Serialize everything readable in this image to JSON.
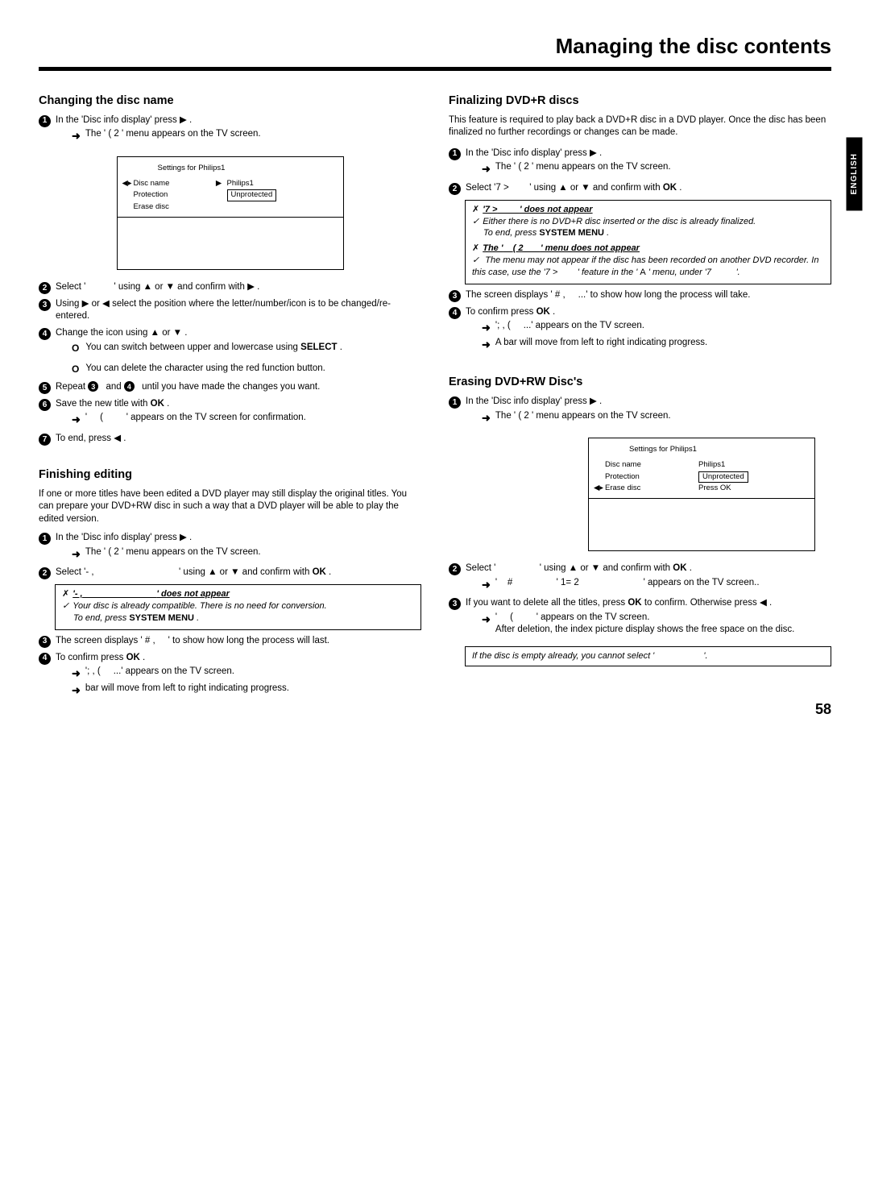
{
  "page_title": "Managing the disc contents",
  "page_number": "58",
  "lang_tab": "ENGLISH",
  "section_changing": {
    "heading": "Changing the disc name",
    "s1a": "In the 'Disc info display' press  ▶ .",
    "s1b_pre": "The '",
    "s1b_mid": "( 2",
    "s1b_post": "' menu appears on the TV screen.",
    "screenshot_title": "Settings for Philips1",
    "screenshot_rows": {
      "r1_label": "Disc name",
      "r1_val": "Philips1",
      "r2_label": "Protection",
      "r2_val": "Unprotected",
      "r3_label": "Erase disc"
    },
    "s2_pre": "Select '",
    "s2_post": "' using  ▲  or  ▼  and confirm with  ▶ .",
    "s3": "Using  ▶  or  ◀  select the position where the letter/number/icon is to be changed/re-entered.",
    "s4": "Change the icon using  ▲  or  ▼ .",
    "s4o1_pre": "You can switch between upper and lowercase using ",
    "s4o1_sel": "SELECT",
    "s4o1_post": " .",
    "s4o2": "You can delete the character using the red function button.",
    "s5_pre": "Repeat ",
    "s5_mid": " and ",
    "s5_post": " until you have made the changes you want.",
    "s6_pre": "Save the new title with  ",
    "s6_ok": "OK",
    "s6_post": " .",
    "s6sub_pre": "'",
    "s6sub_mid": "(",
    "s6sub_post": "' appears on the TV screen for confirmation.",
    "s7": "To end, press  ◀ ."
  },
  "section_finishing": {
    "heading": "Finishing editing",
    "intro": "If one or more titles have been edited a DVD player may still display the original titles. You can prepare your DVD+RW disc in such a way that a DVD player will be able to play the edited version.",
    "s1a": "In the 'Disc info display' press  ▶ .",
    "s1b_pre": "The '",
    "s1b_mid": "( 2",
    "s1b_post": "' menu appears on the TV screen.",
    "s2_pre": "Select '- ,",
    "s2_mid": "' using  ▲  or  ▼  and confirm with  ",
    "s2_ok": "OK",
    "s2_post": " .",
    "tb_title_pre": "'- ,",
    "tb_title_post": "' does not appear",
    "tb_line1": "Your disc is already compatible. There is no need for conversion.",
    "tb_line2_pre": "To end, press  ",
    "tb_line2_sys": "SYSTEM MENU",
    "tb_line2_post": " .",
    "s3_pre": "The screen displays '",
    "s3_mid": "#    ,",
    "s3_post": "' to show how long the process will last.",
    "s4_pre": "To confirm press  ",
    "s4_ok": "OK",
    "s4_post": " .",
    "s4sub_pre": "'; , (",
    "s4sub_post": "...' appears on the TV screen.",
    "s4sub2": "bar will move from left to right indicating progress."
  },
  "section_finalizing": {
    "heading": "Finalizing DVD+R discs",
    "intro": "This feature is required to play back a DVD+R disc in a DVD player. Once the disc has been finalized no further recordings or changes can be made.",
    "s1a": "In the 'Disc info display' press  ▶ .",
    "s1b_pre": "The '",
    "s1b_mid": "( 2",
    "s1b_post": "' menu appears on the TV screen.",
    "s2_pre": "Select '7    >",
    "s2_mid": "' using  ▲  or  ▼  and confirm with  ",
    "s2_ok": "OK",
    "s2_post": " .",
    "tbA_title_pre": "'7    >",
    "tbA_title_post": "' does not appear",
    "tbA_l1": "Either there is no DVD+R disc inserted or the disc is already finalized.",
    "tbA_l2_pre": "To end, press  ",
    "tbA_l2_sys": "SYSTEM MENU",
    "tbA_l2_post": " .",
    "tbB_title_pre": "The '",
    "tbB_title_mid": "( 2",
    "tbB_title_post": "' menu does not appear",
    "tbB_l1_pre": "The menu may not appear if the disc has been recorded on another DVD recorder. In this case, use the '7    >",
    "tbB_l1_post": "' feature in the '",
    "tbB_l1_A": "A",
    "tbB_l1_mid": "' menu, under '7",
    "tbB_l1_end": "'.",
    "s3_pre": "The screen displays '",
    "s3_mid": "#    ,",
    "s3_post": "...' to show how long the process will take.",
    "s4_pre": "To confirm press  ",
    "s4_ok": "OK",
    "s4_post": " .",
    "s4sub_pre": "'; , (",
    "s4sub_post": "...' appears on the TV screen.",
    "s4sub2": "A bar will move from left to right indicating progress."
  },
  "section_erasing": {
    "heading": "Erasing DVD+RW Disc's",
    "s1a": "In the 'Disc info display' press  ▶ .",
    "s1b_pre": "The '",
    "s1b_mid": "( 2",
    "s1b_post": "' menu appears on the TV screen.",
    "screenshot_title": "Settings for Philips1",
    "screenshot_rows": {
      "r1_label": "Disc name",
      "r1_val": "Philips1",
      "r2_label": "Protection",
      "r2_val": "Unprotected",
      "r3_label": "Erase disc",
      "r3_val": "Press OK"
    },
    "s2_pre": "Select '",
    "s2_mid": "' using  ▲  or  ▼  and confirm with  ",
    "s2_ok": "OK",
    "s2_post": " .",
    "s2sub_pre": "'",
    "s2sub_mid1": "#",
    "s2sub_mid2": "'    1=    2",
    "s2sub_post": "' appears on the TV screen..",
    "s3_pre": "If you want to delete all the titles, press  ",
    "s3_ok": "OK",
    "s3_mid": "  to confirm. Otherwise press  ◀ .",
    "s3sub_pre": "'",
    "s3sub_mid": "(",
    "s3sub_post": "' appears on the TV screen.",
    "s3sub2": "After deletion, the index picture display shows the free space on the disc.",
    "note": "If the disc is empty already, you cannot select '",
    "note_end": "'."
  }
}
